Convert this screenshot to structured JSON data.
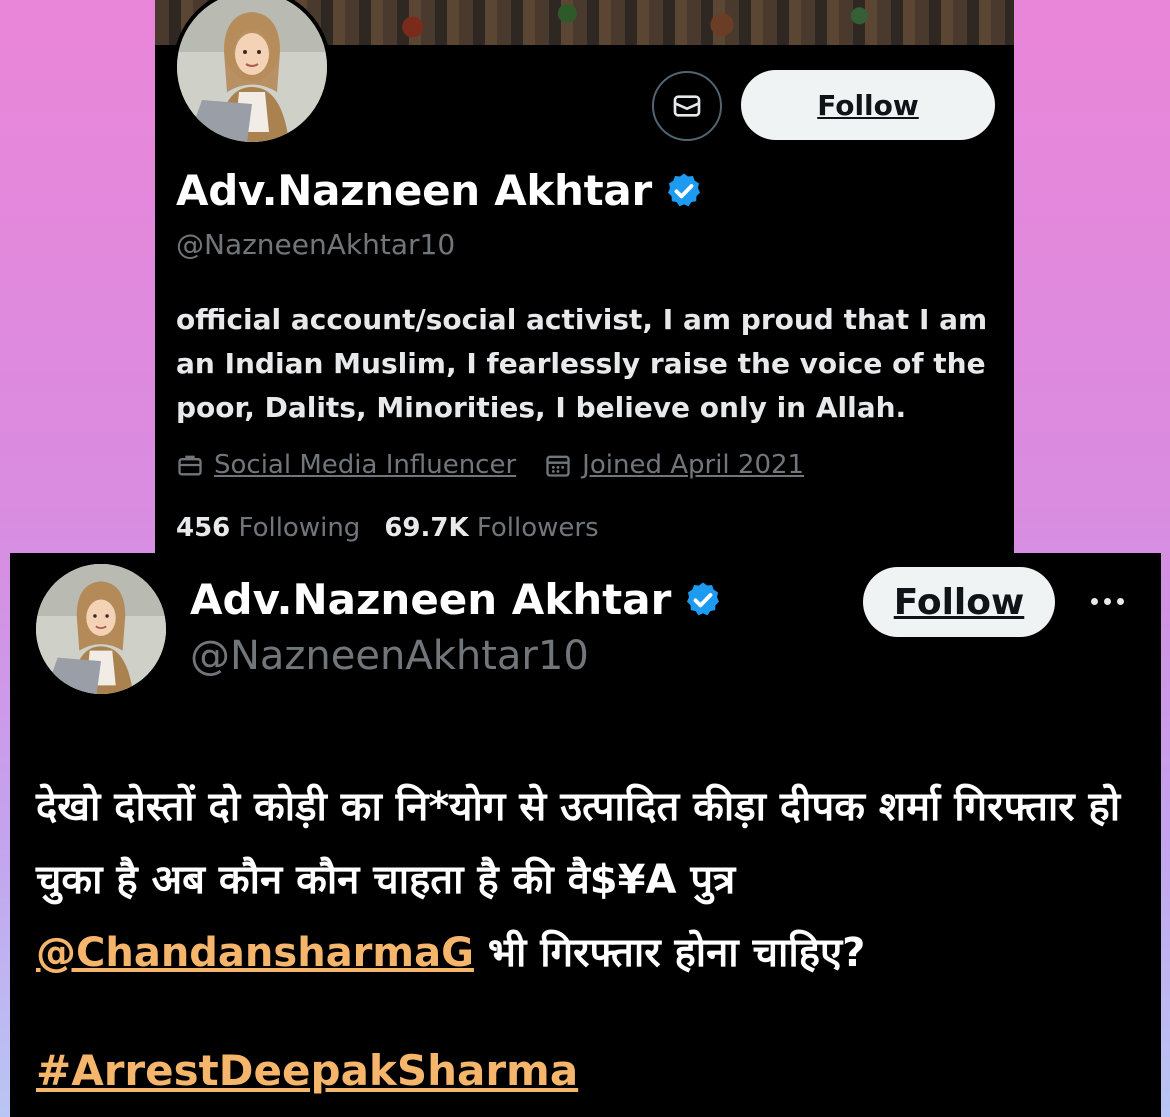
{
  "profile": {
    "name": "Adv.Nazneen Akhtar",
    "handle": "@NazneenAkhtar10",
    "bio": "official account/social activist, I am proud that I am an Indian Muslim, I fearlessly raise the voice of the poor, Dalits, Minorities, I believe only in Allah.",
    "category": "Social Media Influencer",
    "joined": "Joined April 2021",
    "following_count": "456",
    "following_label": "Following",
    "followers_count": "69.7K",
    "followers_label": "Followers",
    "follow_label": "Follow",
    "message_icon": "envelope-icon"
  },
  "tweet": {
    "name": "Adv.Nazneen Akhtar",
    "handle": "@NazneenAkhtar10",
    "follow_label": "Follow",
    "text_part1": "देखो दोस्तों दो कोड़ी का नि*योग से उत्पादित कीड़ा दीपक शर्मा गिरफ्तार हो चुका है अब कौन कौन चाहता है की वै$¥A पुत्र ",
    "mention": "@ChandansharmaG",
    "text_part2": " भी गिरफ्तार होना चाहिए?",
    "hashtag": "#ArrestDeepakSharma"
  },
  "colors": {
    "verified": "#1d9bf0",
    "link": "#f5b66c",
    "muted": "#71767b",
    "button_bg": "#eff3f4"
  }
}
